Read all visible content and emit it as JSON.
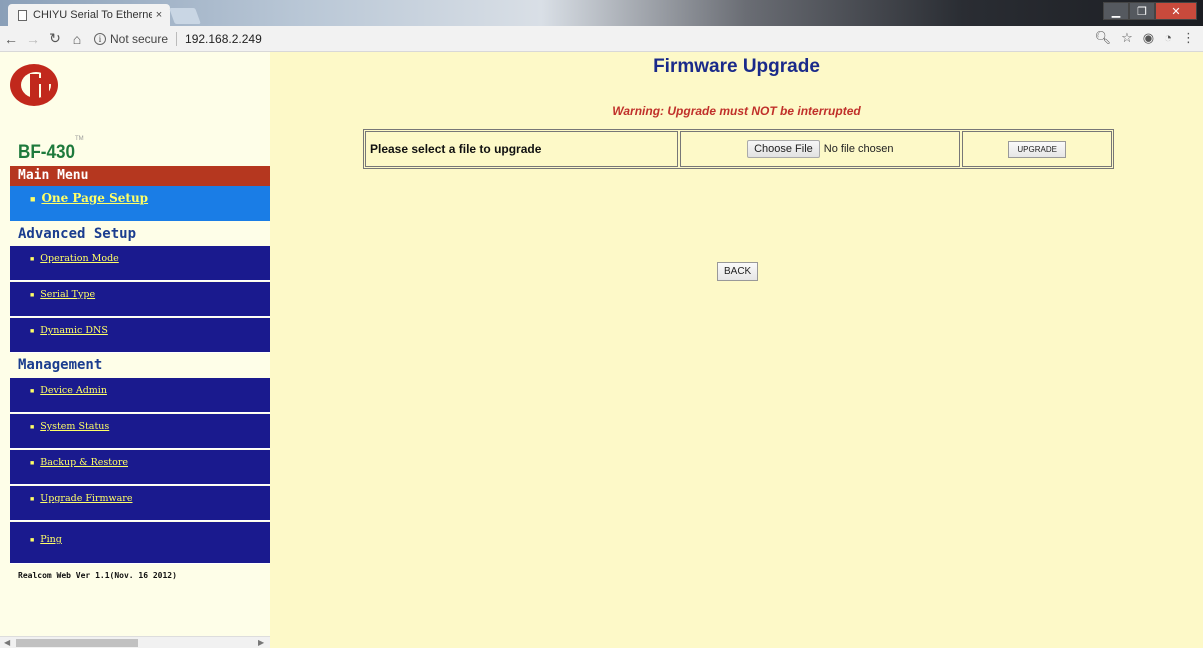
{
  "browser": {
    "tab_title": "CHIYU Serial To Ethernet",
    "tab_close": "×",
    "security_label": "Not secure",
    "url": "192.168.2.249"
  },
  "sidebar": {
    "tm": "TM",
    "model": "BF-430",
    "main_menu_header": "Main Menu",
    "one_page_setup": "One Page Setup",
    "advanced_header": "Advanced Setup",
    "advanced_items": [
      {
        "label": "Operation Mode"
      },
      {
        "label": "Serial Type"
      },
      {
        "label": "Dynamic DNS"
      }
    ],
    "management_header": "Management",
    "management_items": [
      {
        "label": "Device Admin"
      },
      {
        "label": "System Status"
      },
      {
        "label": "Backup & Restore"
      },
      {
        "label": "Upgrade Firmware"
      },
      {
        "label": "Ping"
      }
    ],
    "version": "Realcom Web Ver 1.1(Nov. 16 2012)"
  },
  "main": {
    "title": "Firmware Upgrade",
    "warning": "Warning: Upgrade must NOT be interrupted",
    "select_label": "Please select a file to upgrade",
    "choose_file": "Choose File",
    "no_file": "No file chosen",
    "upgrade_button": "UPGRADE",
    "back_button": "BACK"
  },
  "colors": {
    "menu_header": "#b5371f",
    "active_item": "#1a7de6",
    "menu_item": "#1a1a8e",
    "link": "#ffff66",
    "warning": "#c0302a",
    "title": "#1a2a8a"
  }
}
